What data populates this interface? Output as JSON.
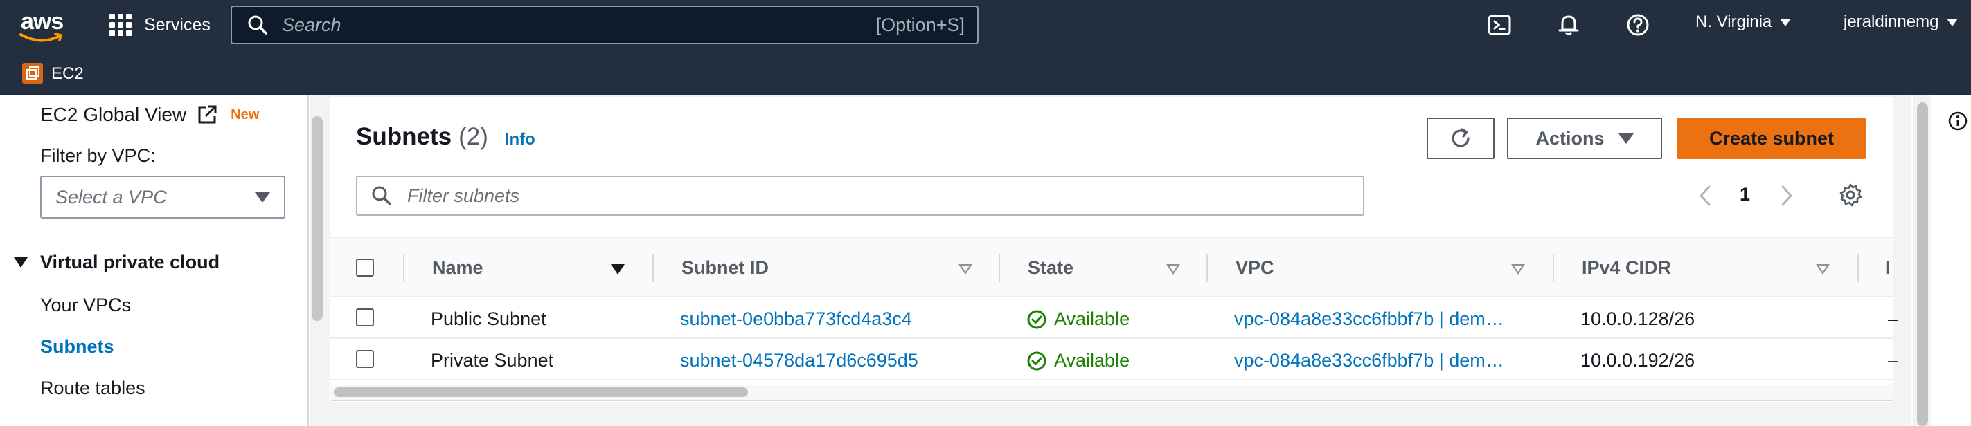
{
  "topnav": {
    "logo_text": "aws",
    "services_label": "Services",
    "search_placeholder": "Search",
    "search_shortcut": "[Option+S]",
    "region": "N. Virginia",
    "user": "jeraldinnemg"
  },
  "subbar": {
    "service_name": "EC2"
  },
  "sidebar": {
    "global_view": "EC2 Global View",
    "new_badge": "New",
    "filter_label": "Filter by VPC:",
    "vpc_select_placeholder": "Select a VPC",
    "section_title": "Virtual private cloud",
    "items": [
      {
        "label": "Your VPCs"
      },
      {
        "label": "Subnets",
        "active": true
      },
      {
        "label": "Route tables"
      }
    ]
  },
  "main": {
    "title": "Subnets",
    "count": "(2)",
    "info_link": "Info",
    "actions_label": "Actions",
    "create_label": "Create subnet",
    "filter_placeholder": "Filter subnets",
    "page": "1"
  },
  "table": {
    "columns": [
      "Name",
      "Subnet ID",
      "State",
      "VPC",
      "IPv4 CIDR",
      "I"
    ],
    "rows": [
      {
        "name": "Public Subnet",
        "subnet_id": "subnet-0e0bba773fcd4a3c4",
        "state": "Available",
        "vpc": "vpc-084a8e33cc6fbbf7b | dem…",
        "cidr": "10.0.0.128/26",
        "extra": "–"
      },
      {
        "name": "Private Subnet",
        "subnet_id": "subnet-04578da17d6c695d5",
        "state": "Available",
        "vpc": "vpc-084a8e33cc6fbbf7b | dem…",
        "cidr": "10.0.0.192/26",
        "extra": "–"
      }
    ]
  },
  "colors": {
    "nav_bg": "#232f3e",
    "accent_orange": "#ec7211",
    "link_blue": "#0073bb",
    "status_green": "#1d8102"
  },
  "icons": [
    "grid-icon",
    "search-icon",
    "cloudshell-icon",
    "bell-icon",
    "help-icon",
    "external-link-icon",
    "refresh-icon",
    "chevron-left-icon",
    "chevron-right-icon",
    "settings-icon",
    "check-circle-icon",
    "info-icon"
  ]
}
